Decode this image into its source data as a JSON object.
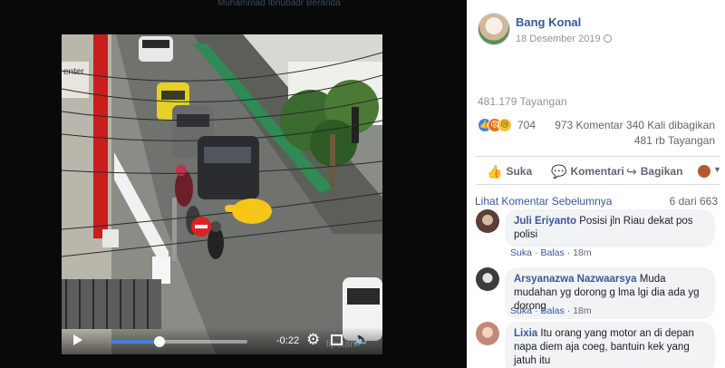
{
  "topbar": {
    "blurred_text": "Muhammad Ibnubadr  Beranda"
  },
  "video": {
    "time_remaining": "-0:22",
    "progress": 0.35,
    "watermark": "liputan"
  },
  "post": {
    "author": "Bang Konal",
    "date": "18 Desember 2019",
    "views_top": "481.179 Tayangan",
    "reaction_count": "704",
    "comments_count": "973 Komentar",
    "shares_count": "340 Kali dibagikan",
    "views_short": "481 rb Tayangan"
  },
  "actions": {
    "like": "Suka",
    "comment": "Komentari",
    "share": "Bagikan"
  },
  "comments_header": {
    "prev_link": "Lihat Komentar Sebelumnya",
    "count": "6 dari 663"
  },
  "comments": [
    {
      "name": "Juli Eriyanto",
      "text": "Posisi jln Riau dekat pos polisi",
      "like": "Suka",
      "reply": "Balas",
      "time": "18m"
    },
    {
      "name": "Arsyanazwa Nazwaarsya",
      "text": "Muda mudahan yg dorong g lma lgi dia ada yg dorong",
      "like": "Suka",
      "reply": "Balas",
      "time": "18m"
    },
    {
      "name": "Lixia",
      "text": "Itu orang yang motor an di depan napa diem aja coeg, bantuin kek yang jatuh itu"
    }
  ]
}
